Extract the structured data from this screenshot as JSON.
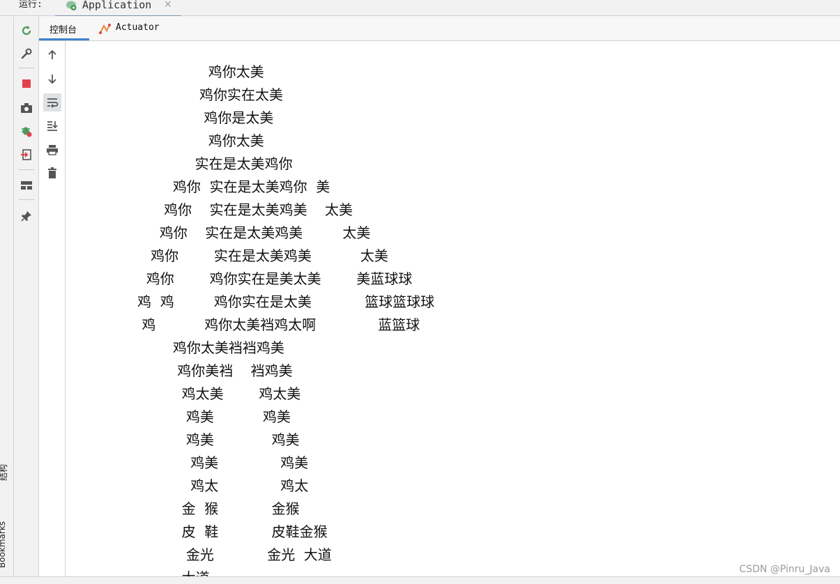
{
  "run_label": "运行:",
  "app_tab": {
    "label": "Application",
    "close": "×"
  },
  "subtabs": {
    "console": "控制台",
    "actuator": "Actuator"
  },
  "side_labels": {
    "structure": "结构",
    "bookmarks": "Bookmarks"
  },
  "console_lines": [
    "                鸡你太美",
    "              鸡你实在太美",
    "               鸡你是太美",
    "                鸡你太美",
    "             实在是太美鸡你",
    "        鸡你  实在是太美鸡你  美",
    "      鸡你    实在是太美鸡美    太美",
    "     鸡你    实在是太美鸡美         太美",
    "   鸡你        实在是太美鸡美           太美",
    "  鸡你        鸡你实在是美太美        美蓝球球",
    "鸡  鸡         鸡你实在是太美            篮球篮球球",
    " 鸡           鸡你太美裆鸡太啊              蓝篮球",
    "        鸡你太美裆裆鸡美",
    "         鸡你美裆    裆鸡美",
    "          鸡太美        鸡太美",
    "           鸡美           鸡美",
    "           鸡美             鸡美",
    "            鸡美              鸡美",
    "            鸡太              鸡太",
    "          金  猴            金猴",
    "          皮  鞋            皮鞋金猴",
    "           金光            金光  大道",
    "          大道"
  ],
  "watermark": "CSDN @Pinru_Java",
  "colors": {
    "accent": "#4083c9",
    "stop": "#e0434b",
    "green": "#4a9c5d"
  },
  "icons": [
    "rerun-icon",
    "wrench-icon",
    "stop-icon",
    "camera-icon",
    "debug-icon",
    "exit-icon",
    "layout-icon",
    "pin-icon",
    "scroll-up-icon",
    "scroll-down-icon",
    "soft-wrap-icon",
    "scroll-to-end-icon",
    "print-icon",
    "trash-icon"
  ]
}
